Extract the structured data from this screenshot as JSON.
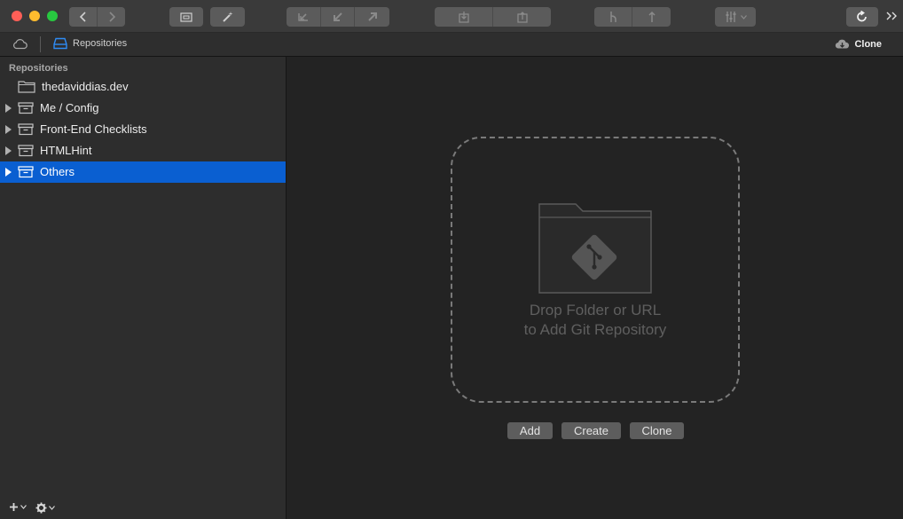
{
  "toolbar": {
    "buttons": [
      "back",
      "forward",
      "open-folder",
      "wand",
      "fetch",
      "pull",
      "push",
      "stash",
      "unstash",
      "branch",
      "tag",
      "merge-options",
      "refresh",
      "overflow"
    ]
  },
  "tabbar": {
    "repositories_label": "Repositories",
    "clone_label": "Clone"
  },
  "sidebar": {
    "heading": "Repositories",
    "items": [
      {
        "label": "thedaviddias.dev",
        "icon": "folder-icon"
      },
      {
        "label": "Me / Config",
        "icon": "archive-box-icon"
      },
      {
        "label": "Front-End Checklists",
        "icon": "archive-box-icon"
      },
      {
        "label": "HTMLHint",
        "icon": "archive-box-icon"
      },
      {
        "label": "Others",
        "icon": "archive-box-icon",
        "selected": true
      }
    ]
  },
  "main": {
    "drop_line1": "Drop Folder or URL",
    "drop_line2": "to Add Git Repository",
    "add_label": "Add",
    "create_label": "Create",
    "clone_label": "Clone"
  },
  "colors": {
    "selection": "#0a5fd1",
    "window_bg": "#232323",
    "sidebar_bg": "#2d2d2d"
  }
}
